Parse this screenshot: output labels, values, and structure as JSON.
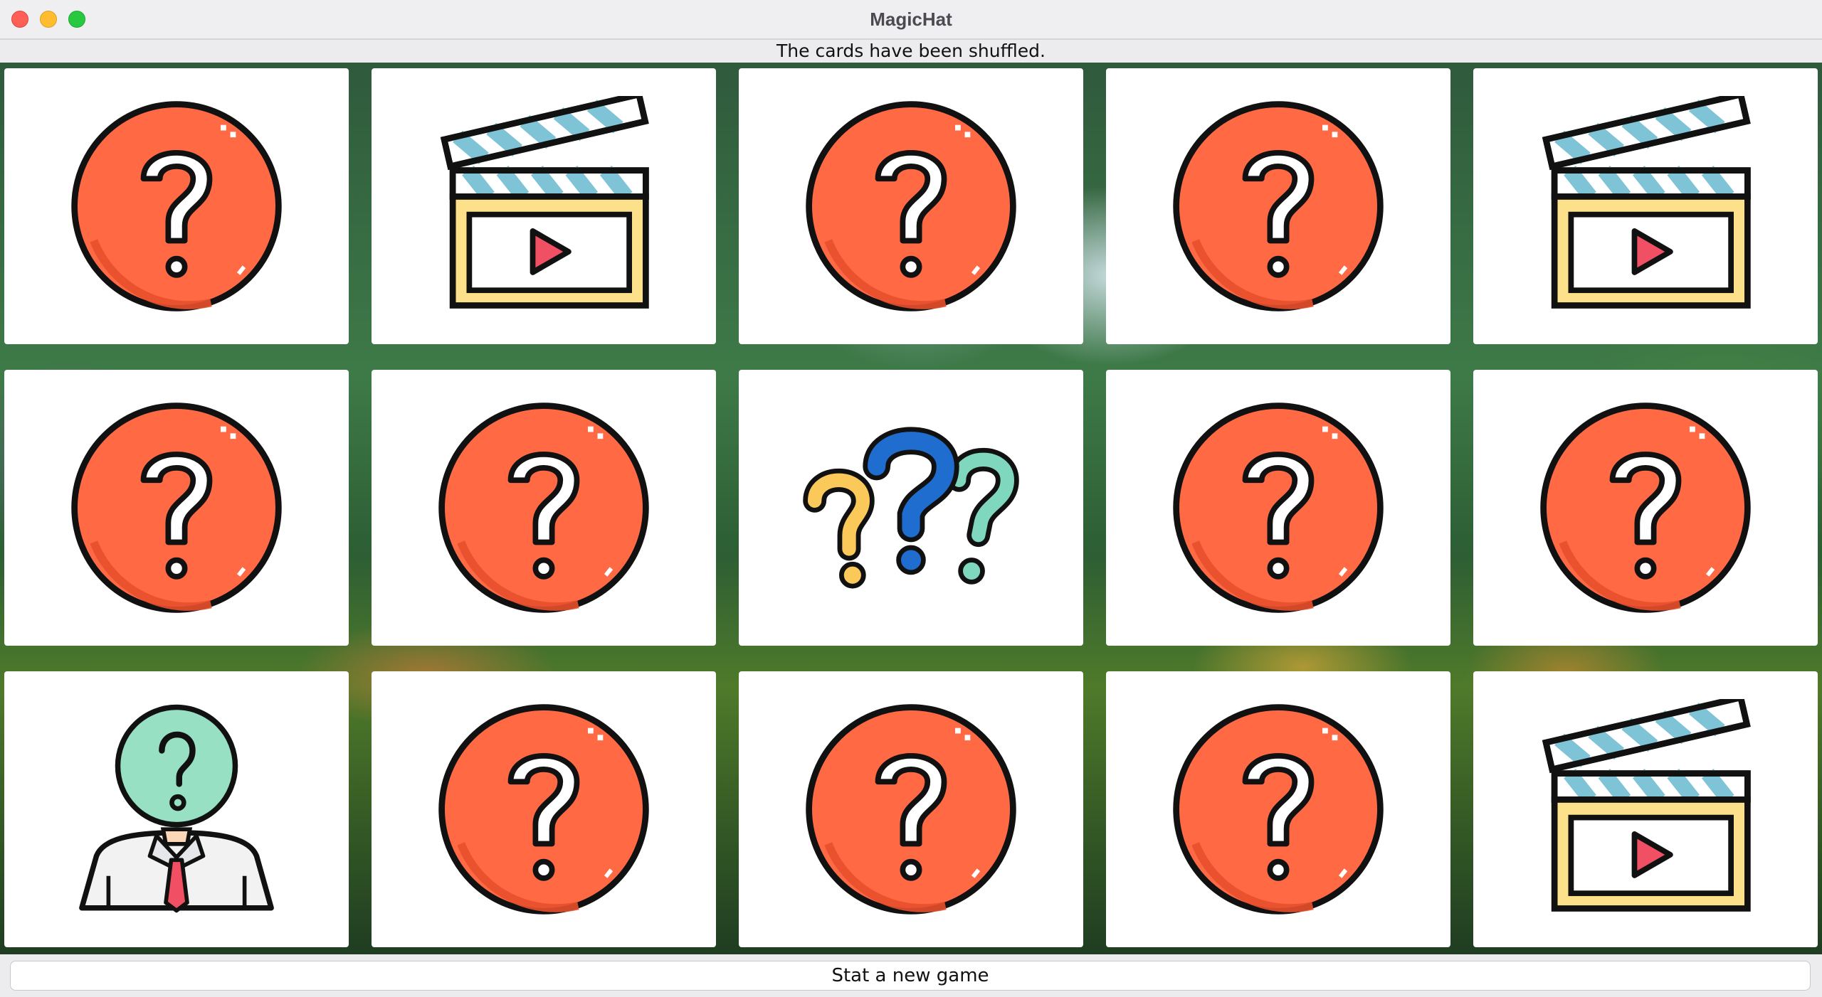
{
  "window": {
    "title": "MagicHat"
  },
  "status": {
    "message": "The cards have been shuffled."
  },
  "board": {
    "rows": 3,
    "columns": 5,
    "cards": [
      {
        "row": 1,
        "col": 1,
        "icon": "question-circle-icon"
      },
      {
        "row": 1,
        "col": 2,
        "icon": "clapperboard-icon"
      },
      {
        "row": 1,
        "col": 3,
        "icon": "question-circle-icon"
      },
      {
        "row": 1,
        "col": 4,
        "icon": "question-circle-icon"
      },
      {
        "row": 1,
        "col": 5,
        "icon": "clapperboard-icon"
      },
      {
        "row": 2,
        "col": 1,
        "icon": "question-circle-icon"
      },
      {
        "row": 2,
        "col": 2,
        "icon": "question-circle-icon"
      },
      {
        "row": 2,
        "col": 3,
        "icon": "question-marks-icon"
      },
      {
        "row": 2,
        "col": 4,
        "icon": "question-circle-icon"
      },
      {
        "row": 2,
        "col": 5,
        "icon": "question-circle-icon"
      },
      {
        "row": 3,
        "col": 1,
        "icon": "unknown-person-icon"
      },
      {
        "row": 3,
        "col": 2,
        "icon": "question-circle-icon"
      },
      {
        "row": 3,
        "col": 3,
        "icon": "question-circle-icon"
      },
      {
        "row": 3,
        "col": 4,
        "icon": "question-circle-icon"
      },
      {
        "row": 3,
        "col": 5,
        "icon": "clapperboard-icon"
      }
    ]
  },
  "controls": {
    "new_game_label": "Stat a new game"
  },
  "colors": {
    "question_circle": "#ff6a45",
    "clapper_stripe": "#7ec4d6",
    "clapper_body": "#fde08a",
    "play": "#f14f63",
    "person_head": "#98e0c4",
    "qm_yellow": "#fbc95a",
    "qm_blue": "#1f6ecf",
    "qm_teal": "#7fd7bd"
  }
}
